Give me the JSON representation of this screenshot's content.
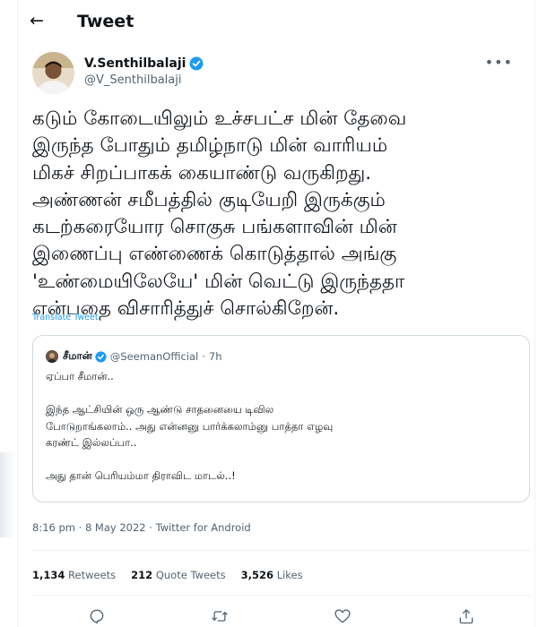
{
  "header": {
    "back_icon": "arrow-left-icon",
    "title": "Tweet"
  },
  "author": {
    "name": "V.Senthilbalaji",
    "handle": "@V_Senthilbalaji",
    "verified_icon": "verified-badge-icon",
    "more_icon": "more-options-icon",
    "more_glyph": "•••"
  },
  "tweet": {
    "text": "கடும் கோடையிலும் உச்சபட்ச மின் தேவை\nஇருந்த போதும் தமிழ்நாடு மின் வாரியம்\nமிகச் சிறப்பாகக் கையாண்டு வருகிறது.\nஅண்ணன் சமீபத்தில் குடியேறி இருக்கும்\nகடற்கரையோர சொகுசு பங்களாவின் மின்\nஇணைப்பு எண்ணைக் கொடுத்தால் அங்கு\n'உண்மையிலேயே' மின் வெட்டு இருந்ததா\nஎன்பதை விசாரித்துச் சொல்கிறேன்.",
    "translate_label": "Translate Tweet"
  },
  "quote": {
    "name": "சீமான்",
    "handle": "@SeemanOfficial",
    "separator": "·",
    "time": "7h",
    "text": "ஏப்பா சீமான்..\n\nஇந்த ஆட்சியின் ஒரு ஆண்டு சாதனையை டிவில\nபோடுறாங்கலாம்.. அது என்னனு பார்க்கலாம்னு பாத்தா எழவு\nகரண்ட் இல்லப்பா..\n\nஅது தான் பெரியம்மா திராவிட மாடல்..!"
  },
  "meta": {
    "timestamp": "8:16 pm · 8 May 2022 · Twitter for Android"
  },
  "stats": {
    "retweets_count": "1,134",
    "retweets_label": "Retweets",
    "quotes_count": "212",
    "quotes_label": "Quote Tweets",
    "likes_count": "3,526",
    "likes_label": "Likes"
  },
  "actions": {
    "reply_icon": "reply-icon",
    "retweet_icon": "retweet-icon",
    "like_icon": "like-heart-icon",
    "share_icon": "share-icon"
  },
  "colors": {
    "link": "#1d9bf0",
    "secondary_text": "#536471",
    "border": "#cfd9de",
    "verified": "#1d9bf0"
  }
}
